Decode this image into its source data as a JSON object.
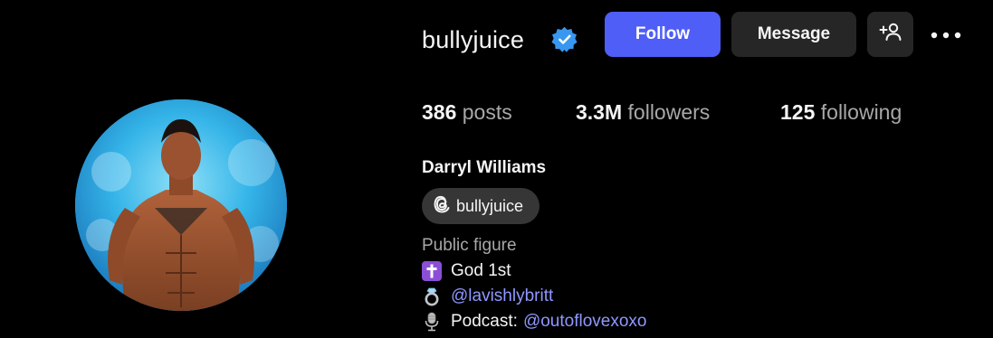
{
  "profile": {
    "username": "bullyjuice",
    "verified": true,
    "full_name": "Darryl Williams",
    "category": "Public figure"
  },
  "actions": {
    "follow_label": "Follow",
    "message_label": "Message",
    "add_user_icon": "person-plus-icon",
    "more_icon": "more-options-icon"
  },
  "stats": {
    "posts_count": "386",
    "posts_label": "posts",
    "followers_count": "3.3M",
    "followers_label": "followers",
    "following_count": "125",
    "following_label": "following"
  },
  "threads": {
    "handle": "bullyjuice",
    "icon": "threads-icon"
  },
  "bio": {
    "line1_text": "God 1st",
    "line1_icon": "cross-emoji-icon",
    "line2_link": "@lavishlybritt",
    "line2_icon": "ring-emoji-icon",
    "line3_prefix": "Podcast:",
    "line3_link": "@outoflovexoxo",
    "line3_icon": "microphone-emoji-icon"
  },
  "colors": {
    "background": "#000000",
    "follow_button": "#4f5ef7",
    "secondary_button": "#262626",
    "link": "#8f98ff",
    "muted_text": "#a8a8a8",
    "verified_badge": "#3897f0"
  }
}
